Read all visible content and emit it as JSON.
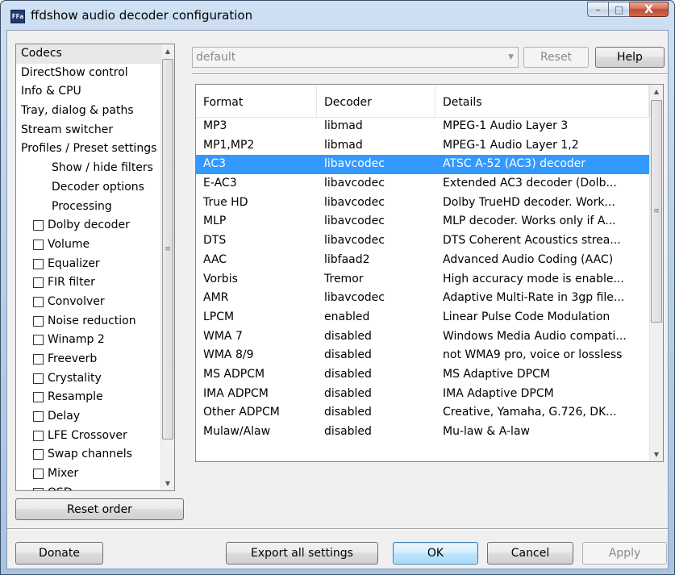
{
  "window": {
    "title": "ffdshow audio decoder configuration",
    "icon_text": "FFa",
    "minimize": "–",
    "maximize": "□",
    "close": "X"
  },
  "sidebar": {
    "items": [
      {
        "label": "Codecs",
        "kind": "top",
        "selected": true
      },
      {
        "label": "DirectShow control",
        "kind": "top"
      },
      {
        "label": "Info & CPU",
        "kind": "top"
      },
      {
        "label": "Tray, dialog & paths",
        "kind": "top"
      },
      {
        "label": "Stream switcher",
        "kind": "top"
      },
      {
        "label": "Profiles / Preset settings",
        "kind": "top"
      },
      {
        "label": "Show / hide filters",
        "kind": "sub"
      },
      {
        "label": "Decoder options",
        "kind": "sub"
      },
      {
        "label": "Processing",
        "kind": "sub"
      },
      {
        "label": "Dolby decoder",
        "kind": "check",
        "checked": false
      },
      {
        "label": "Volume",
        "kind": "check",
        "checked": false
      },
      {
        "label": "Equalizer",
        "kind": "check",
        "checked": false
      },
      {
        "label": "FIR filter",
        "kind": "check",
        "checked": false
      },
      {
        "label": "Convolver",
        "kind": "check",
        "checked": false
      },
      {
        "label": "Noise reduction",
        "kind": "check",
        "checked": false
      },
      {
        "label": "Winamp 2",
        "kind": "check",
        "checked": false
      },
      {
        "label": "Freeverb",
        "kind": "check",
        "checked": false
      },
      {
        "label": "Crystality",
        "kind": "check",
        "checked": false
      },
      {
        "label": "Resample",
        "kind": "check",
        "checked": false
      },
      {
        "label": "Delay",
        "kind": "check",
        "checked": false
      },
      {
        "label": "LFE Crossover",
        "kind": "check",
        "checked": false
      },
      {
        "label": "Swap channels",
        "kind": "check",
        "checked": false
      },
      {
        "label": "Mixer",
        "kind": "check",
        "checked": false
      },
      {
        "label": "OSD",
        "kind": "check",
        "checked": false
      }
    ],
    "reset_order_label": "Reset order"
  },
  "preset": {
    "value": "default",
    "reset_label": "Reset",
    "help_label": "Help"
  },
  "codecs": {
    "columns": [
      "Format",
      "Decoder",
      "Details"
    ],
    "rows": [
      [
        "MP3",
        "libmad",
        "MPEG-1 Audio Layer 3"
      ],
      [
        "MP1,MP2",
        "libmad",
        "MPEG-1 Audio Layer 1,2"
      ],
      [
        "AC3",
        "libavcodec",
        "ATSC A-52 (AC3) decoder"
      ],
      [
        "E-AC3",
        "libavcodec",
        "Extended AC3 decoder (Dolb..."
      ],
      [
        "True HD",
        "libavcodec",
        "Dolby TrueHD decoder. Work..."
      ],
      [
        "MLP",
        "libavcodec",
        "MLP decoder. Works only if A..."
      ],
      [
        "DTS",
        "libavcodec",
        "DTS Coherent Acoustics strea..."
      ],
      [
        "AAC",
        "libfaad2",
        "Advanced Audio Coding (AAC)"
      ],
      [
        "Vorbis",
        "Tremor",
        "High accuracy mode is enable..."
      ],
      [
        "AMR",
        "libavcodec",
        "Adaptive Multi-Rate in 3gp file..."
      ],
      [
        "LPCM",
        "enabled",
        "Linear Pulse Code Modulation"
      ],
      [
        "WMA 7",
        "disabled",
        "Windows Media Audio compati..."
      ],
      [
        "WMA 8/9",
        "disabled",
        "not WMA9 pro, voice or lossless"
      ],
      [
        "MS ADPCM",
        "disabled",
        "MS Adaptive DPCM"
      ],
      [
        "IMA ADPCM",
        "disabled",
        "IMA Adaptive DPCM"
      ],
      [
        "Other ADPCM",
        "disabled",
        "Creative, Yamaha, G.726, DK..."
      ],
      [
        "Mulaw/Alaw",
        "disabled",
        "Mu-law & A-law"
      ]
    ],
    "selected_row": 2
  },
  "footer": {
    "donate_label": "Donate",
    "export_label": "Export all settings",
    "ok_label": "OK",
    "cancel_label": "Cancel",
    "apply_label": "Apply"
  },
  "colors": {
    "selection": "#3399ff",
    "sidebar_selection": "#e8e8e8"
  }
}
